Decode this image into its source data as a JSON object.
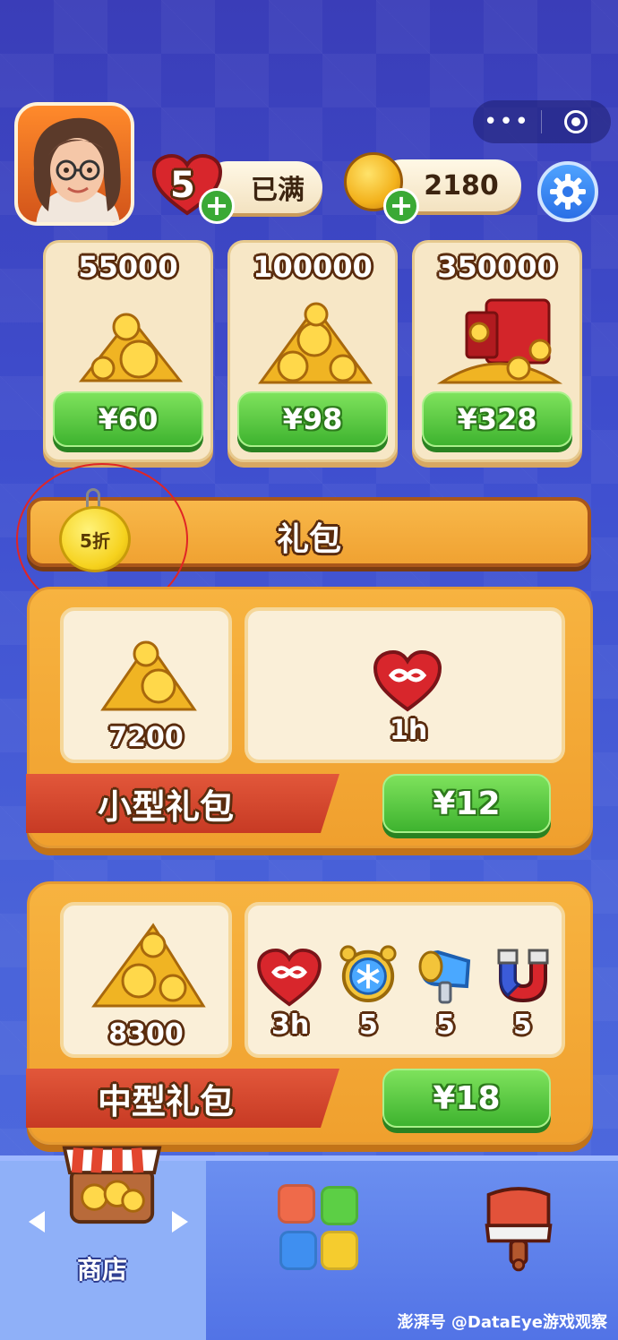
{
  "top_bar": {
    "menu_dots_label": "•••",
    "lives": {
      "count": "5",
      "status": "已满"
    },
    "coins": {
      "balance": "2180"
    },
    "plus_symbol": "+"
  },
  "coin_offers": [
    {
      "amount": "55000",
      "price": "¥60"
    },
    {
      "amount": "100000",
      "price": "¥98"
    },
    {
      "amount": "350000",
      "price": "¥328"
    }
  ],
  "gift_banner": {
    "title": "礼包",
    "discount_tag": "5折"
  },
  "packs": [
    {
      "name": "小型礼包",
      "coins": "7200",
      "items": [
        {
          "icon": "infinite-heart-icon",
          "label": "1h"
        }
      ],
      "price": "¥12"
    },
    {
      "name": "中型礼包",
      "coins": "8300",
      "items": [
        {
          "icon": "infinite-heart-icon",
          "label": "3h"
        },
        {
          "icon": "freeze-clock-icon",
          "label": "5"
        },
        {
          "icon": "hammer-icon",
          "label": "5"
        },
        {
          "icon": "magnet-icon",
          "label": "5"
        }
      ],
      "price": "¥18"
    }
  ],
  "bottom_nav": {
    "shop_label": "商店"
  },
  "watermark": "澎湃号 @DataEye游戏观察",
  "colors": {
    "background": "#3f4fcf",
    "button_green": "#3eb32f",
    "banner_orange": "#f0a232",
    "ribbon_red": "#c73a24"
  }
}
